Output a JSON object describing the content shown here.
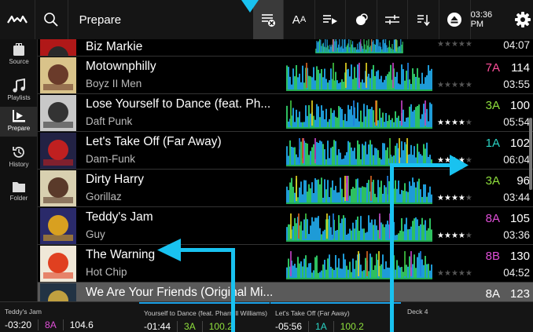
{
  "topbar": {
    "title": "Prepare",
    "time": "03:36 PM",
    "font_size_label": "AA"
  },
  "sidebar": {
    "items": [
      {
        "label": "Source",
        "icon": "usb-drive-icon"
      },
      {
        "label": "Playlists",
        "icon": "music-note-icon"
      },
      {
        "label": "Prepare",
        "icon": "prepare-icon",
        "active": true
      },
      {
        "label": "History",
        "icon": "history-icon"
      },
      {
        "label": "Folder",
        "icon": "folder-icon"
      }
    ]
  },
  "tracks": [
    {
      "title": "Biz Markie",
      "artist": "",
      "key": "",
      "key_color": "#ffffff",
      "bpm": "",
      "rating": 0,
      "duration": "04:07",
      "wave": "#1e9bd7"
    },
    {
      "title": "Motownphilly",
      "artist": "Boyz II Men",
      "key": "7A",
      "key_color": "#ff4f9a",
      "bpm": "114",
      "rating": 0,
      "duration": "03:55",
      "wave": "#1e9bd7"
    },
    {
      "title": "Lose Yourself to Dance (feat. Ph...",
      "artist": "Daft Punk",
      "key": "3A",
      "key_color": "#8fe03d",
      "bpm": "100",
      "rating": 4,
      "duration": "05:54",
      "wave": "#1e9bd7"
    },
    {
      "title": "Let's Take Off (Far Away)",
      "artist": "Dam-Funk",
      "key": "1A",
      "key_color": "#2ad3c4",
      "bpm": "102",
      "rating": 4,
      "duration": "06:04",
      "wave": "#1e9bd7"
    },
    {
      "title": "Dirty Harry",
      "artist": "Gorillaz",
      "key": "3A",
      "key_color": "#8fe03d",
      "bpm": "96",
      "rating": 4,
      "duration": "03:44",
      "wave": "#1e9bd7"
    },
    {
      "title": "Teddy's Jam",
      "artist": "Guy",
      "key": "8A",
      "key_color": "#e04fd8",
      "bpm": "105",
      "rating": 4,
      "duration": "03:36",
      "wave": "#1e9bd7"
    },
    {
      "title": "The Warning",
      "artist": "Hot Chip",
      "key": "8B",
      "key_color": "#e04fd8",
      "bpm": "130",
      "rating": 0,
      "duration": "04:52",
      "wave": "#1e9bd7"
    },
    {
      "title": "We Are Your Friends (Original Mi...",
      "artist": "",
      "key": "8A",
      "key_color": "#ffffff",
      "bpm": "123",
      "rating": 0,
      "duration": "",
      "wave": "#8a8a8a"
    }
  ],
  "decks": [
    {
      "title": "Teddy's Jam",
      "time": "-03:20",
      "key": "8A",
      "key_color": "#e04fd8",
      "bpm": "104.6"
    },
    {
      "title": "Yourself to Dance (feat. Pharrell Williams)",
      "time": "-01:44",
      "key": "3A",
      "key_color": "#8fe03d",
      "bpm": "100.2"
    },
    {
      "title": "Let's Take Off (Far Away)",
      "time": "-05:56",
      "key": "1A",
      "key_color": "#2ad3c4",
      "bpm": "100.2"
    },
    {
      "title": "Deck 4",
      "time": "",
      "key": "",
      "key_color": "#ffffff",
      "bpm": ""
    }
  ],
  "colors": {
    "arrow": "#19c2f0",
    "accent": "#1aa0e6"
  }
}
